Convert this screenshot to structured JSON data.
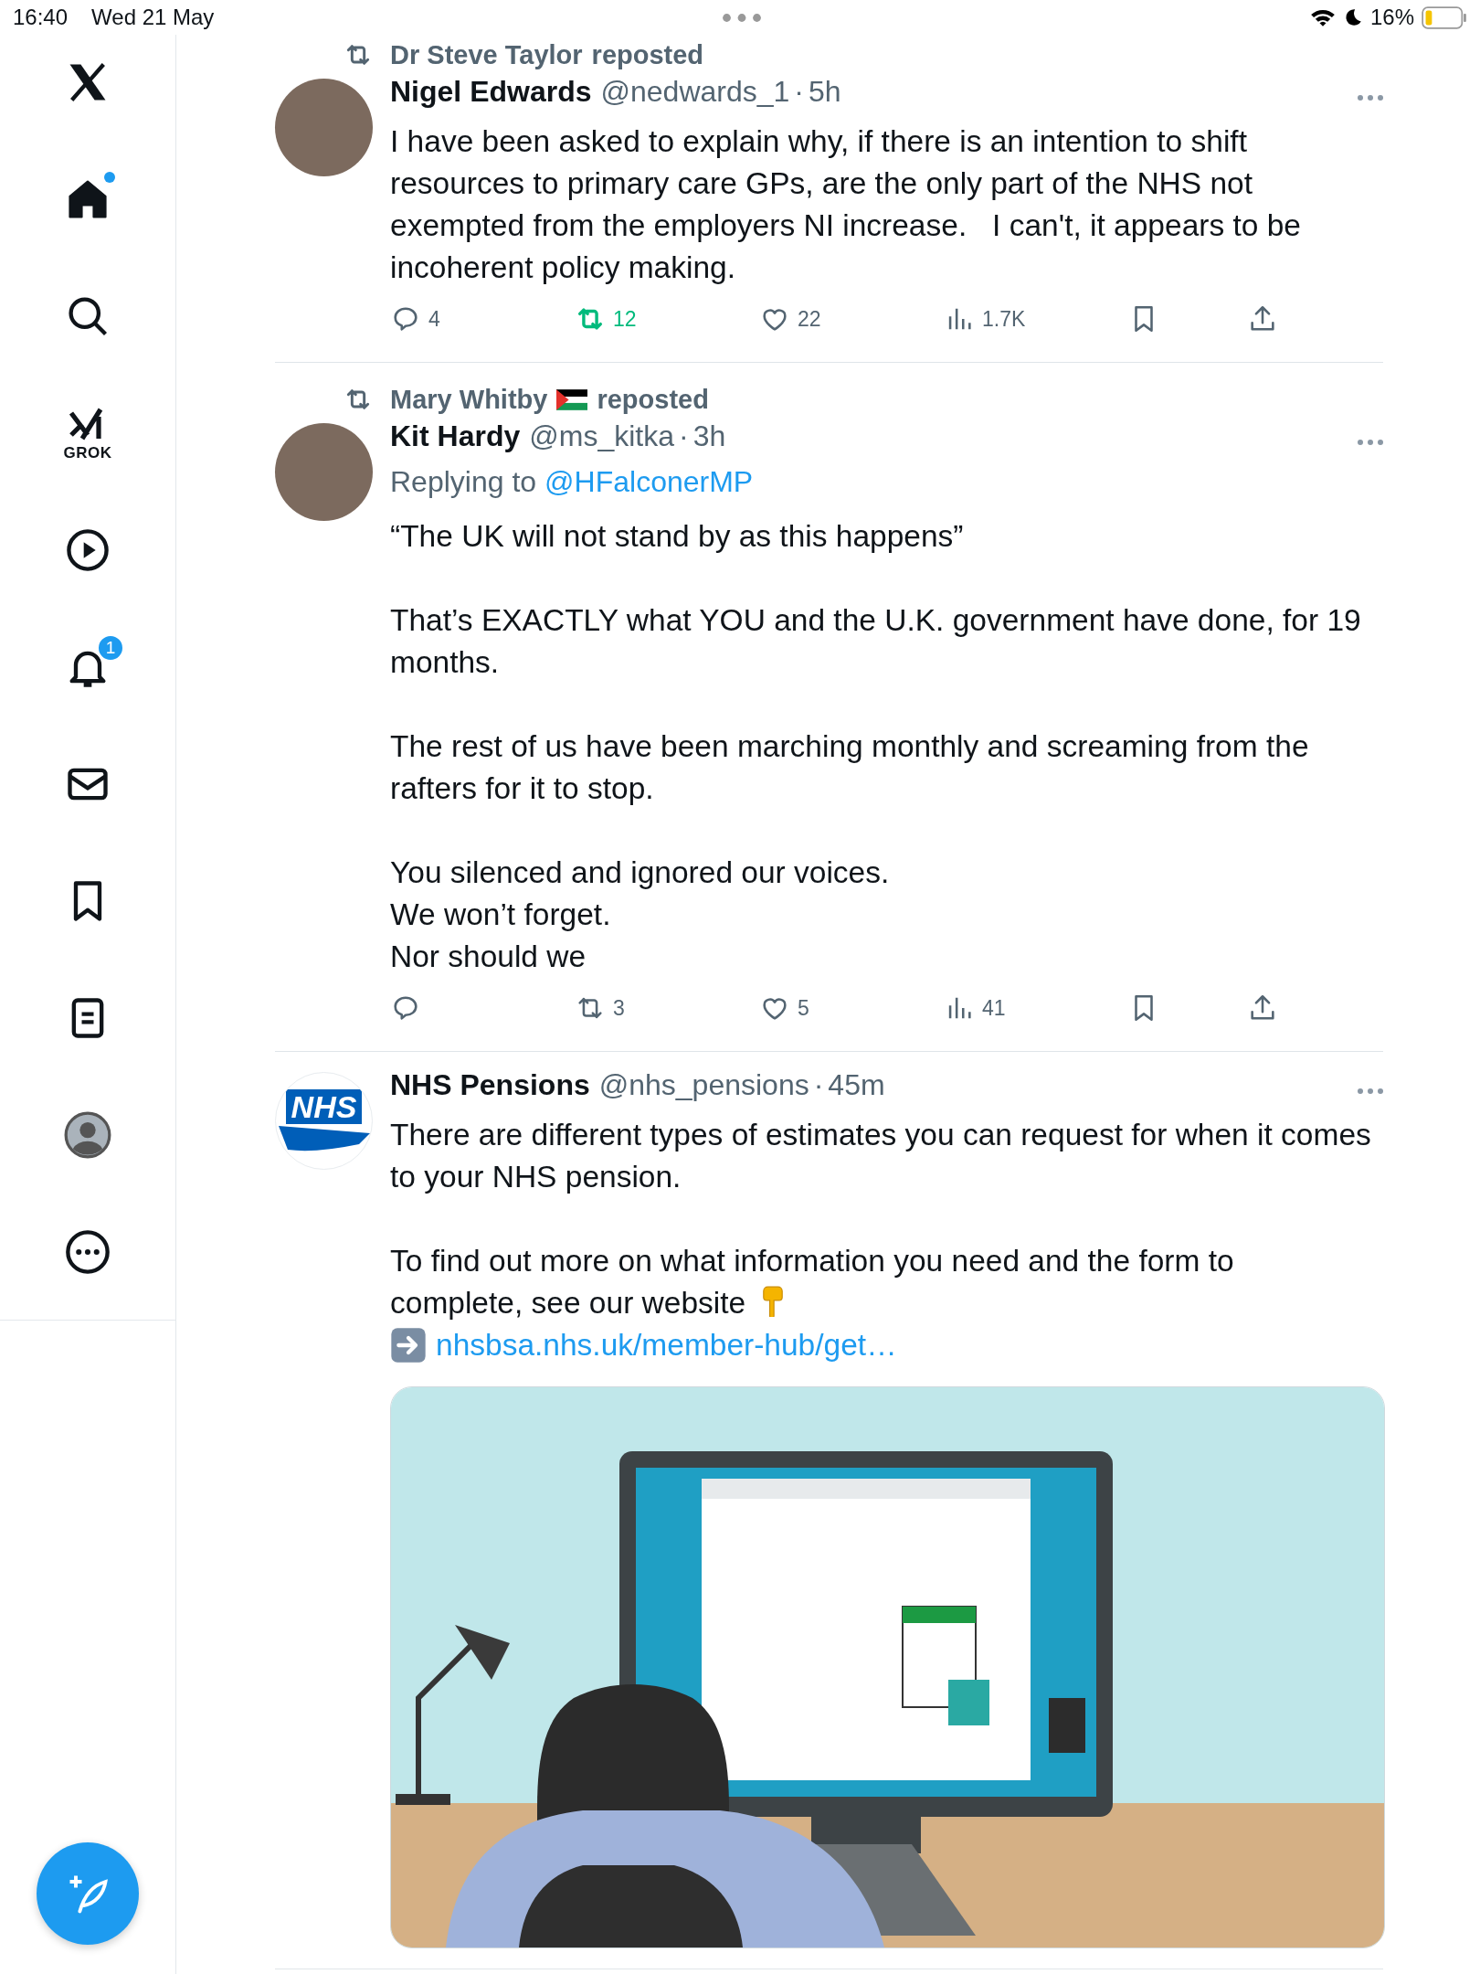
{
  "status_bar": {
    "time": "16:40",
    "date": "Wed 21 May",
    "battery": "16%"
  },
  "sidebar": {
    "nav": [
      {
        "kind": "logo"
      },
      {
        "kind": "home",
        "selected": true,
        "dot": true
      },
      {
        "kind": "search",
        "selected": false
      },
      {
        "kind": "grok",
        "label": "GROK",
        "selected": false
      },
      {
        "kind": "video",
        "selected": false
      },
      {
        "kind": "notifications",
        "badge": "1",
        "selected": false
      },
      {
        "kind": "messages",
        "selected": false
      },
      {
        "kind": "bookmarks",
        "selected": false
      },
      {
        "kind": "lists",
        "selected": false
      },
      {
        "kind": "profile",
        "selected": false
      },
      {
        "kind": "more",
        "selected": false
      }
    ]
  },
  "tweets": [
    {
      "repost": {
        "name": "Dr Steve Taylor",
        "flag": false,
        "suffix": "reposted"
      },
      "avatar": {
        "kind": "photo"
      },
      "name": "Nigel Edwards",
      "handle": "@nedwards_1",
      "separator": "·",
      "time": "5h",
      "body": [
        {
          "lines": [
            "I have been asked to explain why, if there is an intention to shift resources to primary care GPs, are the only part of the NHS not exempted from the employers NI increase.   I can't, it appears to be incoherent policy making."
          ]
        }
      ],
      "actions": {
        "replies": "4",
        "reposts": "12",
        "likes": "22",
        "views": "1.7K",
        "reposted": true
      }
    },
    {
      "repost": {
        "name": "Mary Whitby",
        "flag": true,
        "suffix": "reposted"
      },
      "avatar": {
        "kind": "photo"
      },
      "name": "Kit Hardy",
      "handle": "@ms_kitka",
      "separator": "·",
      "time": "3h",
      "replying_prefix": "Replying to",
      "replying_to": "@HFalconerMP",
      "body": [
        {
          "lines": [
            "“The UK will not stand by as this happens”"
          ]
        },
        {
          "lines": [
            "That’s EXACTLY what YOU and the U.K. government have done, for 19 months."
          ]
        },
        {
          "lines": [
            "The rest of us have been marching monthly and screaming from the rafters for it to stop."
          ]
        },
        {
          "lines": [
            "You silenced and ignored our voices.",
            "We won’t forget.",
            "Nor should we"
          ]
        }
      ],
      "actions": {
        "reposts": "3",
        "likes": "5",
        "views": "41",
        "reposted": false
      }
    },
    {
      "avatar": {
        "kind": "logo",
        "text": "NHS"
      },
      "name": "NHS Pensions",
      "handle": "@nhs_pensions",
      "separator": "·",
      "time": "45m",
      "body": [
        {
          "lines": [
            "There are different types of estimates you can request for when it comes to your NHS pension."
          ]
        },
        {
          "lines": [
            "To find out more on what information you need and the form to",
            "complete, see our website"
          ],
          "pointer": true
        }
      ],
      "link": {
        "text": "nhsbsa.nhs.uk/member-hub/get…"
      },
      "media": {
        "kind": "illustration"
      }
    }
  ]
}
